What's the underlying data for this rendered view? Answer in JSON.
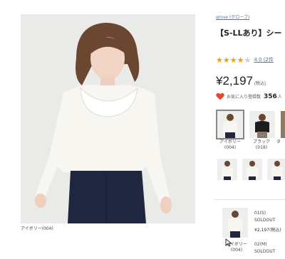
{
  "main_image": {
    "caption": "アイボリー(004)"
  },
  "product": {
    "brand": "grove (グローブ)",
    "title": "【S-LLあり】シー",
    "rating": {
      "stars": 4,
      "max": 5,
      "text": "4.0 (2件"
    },
    "price": "¥2,197",
    "tax_label": "(税込)",
    "favorite": {
      "label": "お気に入り登録数",
      "count": "356",
      "unit": "人"
    }
  },
  "colors": [
    {
      "label": "アイボリー\n(004)",
      "selected": true,
      "tone": "#f1f0ea"
    },
    {
      "label": "ブラック\n(019)",
      "selected": false,
      "tone": "#1d1d1d"
    },
    {
      "label": "タ",
      "selected": false,
      "tone": "#8a7a66"
    }
  ],
  "size_rows": [
    {
      "size": "01(S)",
      "status": "SOLDOUT",
      "price": "¥2,197(税込)"
    },
    {
      "size": "02(M)",
      "status": "SOLDOUT"
    }
  ],
  "size_thumb_label": "アイボリー\n(004)",
  "accent": "#f2a10a",
  "link_color": "#4a6fb5",
  "heart_color": "#e8462f"
}
